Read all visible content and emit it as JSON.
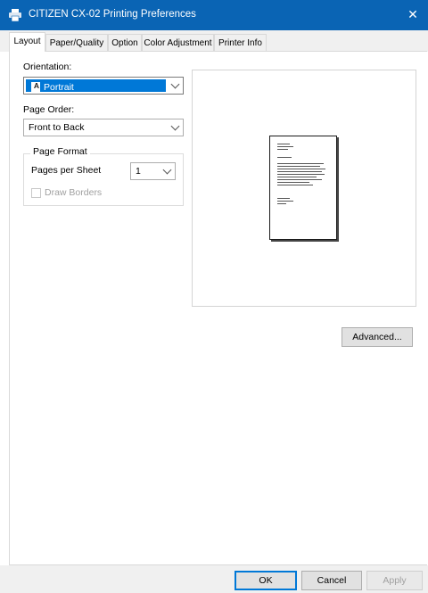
{
  "window": {
    "title": "CITIZEN CX-02 Printing Preferences",
    "close_glyph": "✕"
  },
  "tabs": [
    {
      "label": "Layout"
    },
    {
      "label": "Paper/Quality"
    },
    {
      "label": "Option"
    },
    {
      "label": "Color Adjustment"
    },
    {
      "label": "Printer Info"
    }
  ],
  "orientation": {
    "label": "Orientation:",
    "value": "Portrait",
    "icon_letter": "A"
  },
  "page_order": {
    "label": "Page Order:",
    "value": "Front to Back"
  },
  "page_format": {
    "title": "Page Format",
    "pages_per_sheet_label": "Pages per Sheet",
    "pages_per_sheet_value": "1",
    "draw_borders_label": "Draw Borders"
  },
  "buttons": {
    "advanced": "Advanced...",
    "ok": "OK",
    "cancel": "Cancel",
    "apply": "Apply"
  },
  "colors": {
    "titlebar": "#0a64b4",
    "selection": "#0078d7"
  }
}
